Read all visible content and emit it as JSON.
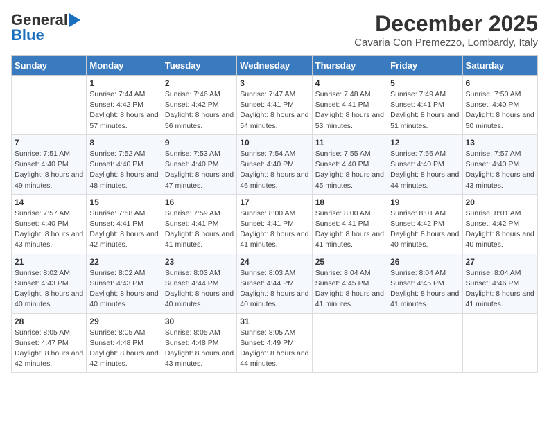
{
  "logo": {
    "line1": "General",
    "line2": "Blue"
  },
  "title": "December 2025",
  "subtitle": "Cavaria Con Premezzo, Lombardy, Italy",
  "weekdays": [
    "Sunday",
    "Monday",
    "Tuesday",
    "Wednesday",
    "Thursday",
    "Friday",
    "Saturday"
  ],
  "weeks": [
    [
      {
        "day": "",
        "sunrise": "",
        "sunset": "",
        "daylight": ""
      },
      {
        "day": "1",
        "sunrise": "Sunrise: 7:44 AM",
        "sunset": "Sunset: 4:42 PM",
        "daylight": "Daylight: 8 hours and 57 minutes."
      },
      {
        "day": "2",
        "sunrise": "Sunrise: 7:46 AM",
        "sunset": "Sunset: 4:42 PM",
        "daylight": "Daylight: 8 hours and 56 minutes."
      },
      {
        "day": "3",
        "sunrise": "Sunrise: 7:47 AM",
        "sunset": "Sunset: 4:41 PM",
        "daylight": "Daylight: 8 hours and 54 minutes."
      },
      {
        "day": "4",
        "sunrise": "Sunrise: 7:48 AM",
        "sunset": "Sunset: 4:41 PM",
        "daylight": "Daylight: 8 hours and 53 minutes."
      },
      {
        "day": "5",
        "sunrise": "Sunrise: 7:49 AM",
        "sunset": "Sunset: 4:41 PM",
        "daylight": "Daylight: 8 hours and 51 minutes."
      },
      {
        "day": "6",
        "sunrise": "Sunrise: 7:50 AM",
        "sunset": "Sunset: 4:40 PM",
        "daylight": "Daylight: 8 hours and 50 minutes."
      }
    ],
    [
      {
        "day": "7",
        "sunrise": "Sunrise: 7:51 AM",
        "sunset": "Sunset: 4:40 PM",
        "daylight": "Daylight: 8 hours and 49 minutes."
      },
      {
        "day": "8",
        "sunrise": "Sunrise: 7:52 AM",
        "sunset": "Sunset: 4:40 PM",
        "daylight": "Daylight: 8 hours and 48 minutes."
      },
      {
        "day": "9",
        "sunrise": "Sunrise: 7:53 AM",
        "sunset": "Sunset: 4:40 PM",
        "daylight": "Daylight: 8 hours and 47 minutes."
      },
      {
        "day": "10",
        "sunrise": "Sunrise: 7:54 AM",
        "sunset": "Sunset: 4:40 PM",
        "daylight": "Daylight: 8 hours and 46 minutes."
      },
      {
        "day": "11",
        "sunrise": "Sunrise: 7:55 AM",
        "sunset": "Sunset: 4:40 PM",
        "daylight": "Daylight: 8 hours and 45 minutes."
      },
      {
        "day": "12",
        "sunrise": "Sunrise: 7:56 AM",
        "sunset": "Sunset: 4:40 PM",
        "daylight": "Daylight: 8 hours and 44 minutes."
      },
      {
        "day": "13",
        "sunrise": "Sunrise: 7:57 AM",
        "sunset": "Sunset: 4:40 PM",
        "daylight": "Daylight: 8 hours and 43 minutes."
      }
    ],
    [
      {
        "day": "14",
        "sunrise": "Sunrise: 7:57 AM",
        "sunset": "Sunset: 4:40 PM",
        "daylight": "Daylight: 8 hours and 43 minutes."
      },
      {
        "day": "15",
        "sunrise": "Sunrise: 7:58 AM",
        "sunset": "Sunset: 4:41 PM",
        "daylight": "Daylight: 8 hours and 42 minutes."
      },
      {
        "day": "16",
        "sunrise": "Sunrise: 7:59 AM",
        "sunset": "Sunset: 4:41 PM",
        "daylight": "Daylight: 8 hours and 41 minutes."
      },
      {
        "day": "17",
        "sunrise": "Sunrise: 8:00 AM",
        "sunset": "Sunset: 4:41 PM",
        "daylight": "Daylight: 8 hours and 41 minutes."
      },
      {
        "day": "18",
        "sunrise": "Sunrise: 8:00 AM",
        "sunset": "Sunset: 4:41 PM",
        "daylight": "Daylight: 8 hours and 41 minutes."
      },
      {
        "day": "19",
        "sunrise": "Sunrise: 8:01 AM",
        "sunset": "Sunset: 4:42 PM",
        "daylight": "Daylight: 8 hours and 40 minutes."
      },
      {
        "day": "20",
        "sunrise": "Sunrise: 8:01 AM",
        "sunset": "Sunset: 4:42 PM",
        "daylight": "Daylight: 8 hours and 40 minutes."
      }
    ],
    [
      {
        "day": "21",
        "sunrise": "Sunrise: 8:02 AM",
        "sunset": "Sunset: 4:43 PM",
        "daylight": "Daylight: 8 hours and 40 minutes."
      },
      {
        "day": "22",
        "sunrise": "Sunrise: 8:02 AM",
        "sunset": "Sunset: 4:43 PM",
        "daylight": "Daylight: 8 hours and 40 minutes."
      },
      {
        "day": "23",
        "sunrise": "Sunrise: 8:03 AM",
        "sunset": "Sunset: 4:44 PM",
        "daylight": "Daylight: 8 hours and 40 minutes."
      },
      {
        "day": "24",
        "sunrise": "Sunrise: 8:03 AM",
        "sunset": "Sunset: 4:44 PM",
        "daylight": "Daylight: 8 hours and 40 minutes."
      },
      {
        "day": "25",
        "sunrise": "Sunrise: 8:04 AM",
        "sunset": "Sunset: 4:45 PM",
        "daylight": "Daylight: 8 hours and 41 minutes."
      },
      {
        "day": "26",
        "sunrise": "Sunrise: 8:04 AM",
        "sunset": "Sunset: 4:45 PM",
        "daylight": "Daylight: 8 hours and 41 minutes."
      },
      {
        "day": "27",
        "sunrise": "Sunrise: 8:04 AM",
        "sunset": "Sunset: 4:46 PM",
        "daylight": "Daylight: 8 hours and 41 minutes."
      }
    ],
    [
      {
        "day": "28",
        "sunrise": "Sunrise: 8:05 AM",
        "sunset": "Sunset: 4:47 PM",
        "daylight": "Daylight: 8 hours and 42 minutes."
      },
      {
        "day": "29",
        "sunrise": "Sunrise: 8:05 AM",
        "sunset": "Sunset: 4:48 PM",
        "daylight": "Daylight: 8 hours and 42 minutes."
      },
      {
        "day": "30",
        "sunrise": "Sunrise: 8:05 AM",
        "sunset": "Sunset: 4:48 PM",
        "daylight": "Daylight: 8 hours and 43 minutes."
      },
      {
        "day": "31",
        "sunrise": "Sunrise: 8:05 AM",
        "sunset": "Sunset: 4:49 PM",
        "daylight": "Daylight: 8 hours and 44 minutes."
      },
      {
        "day": "",
        "sunrise": "",
        "sunset": "",
        "daylight": ""
      },
      {
        "day": "",
        "sunrise": "",
        "sunset": "",
        "daylight": ""
      },
      {
        "day": "",
        "sunrise": "",
        "sunset": "",
        "daylight": ""
      }
    ]
  ]
}
